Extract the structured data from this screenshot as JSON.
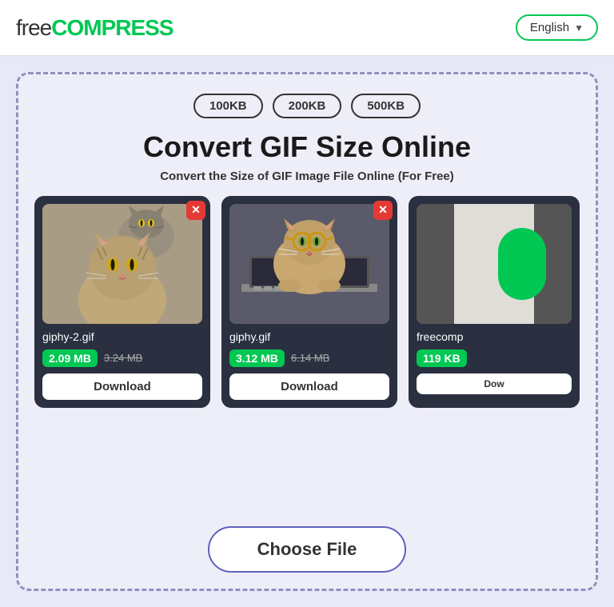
{
  "header": {
    "logo_free": "free",
    "logo_compress": "COMPRESS",
    "lang_label": "English",
    "lang_chevron": "▼"
  },
  "presets": {
    "items": [
      "100KB",
      "200KB",
      "500KB"
    ]
  },
  "hero": {
    "title": "Convert GIF Size Online",
    "subtitle": "Convert the Size of GIF Image File Online (For Free)"
  },
  "files": [
    {
      "name": "giphy-2.gif",
      "size_new": "2.09 MB",
      "size_old": "3.24 MB",
      "download_label": "Download",
      "type": "cat1"
    },
    {
      "name": "giphy.gif",
      "size_new": "3.12 MB",
      "size_old": "6.14 MB",
      "download_label": "Download",
      "type": "cat2"
    },
    {
      "name": "freecomp",
      "size_new": "119 KB",
      "size_old": "",
      "download_label": "Dow",
      "type": "cat3"
    }
  ],
  "choose_file": {
    "label": "Choose File"
  }
}
